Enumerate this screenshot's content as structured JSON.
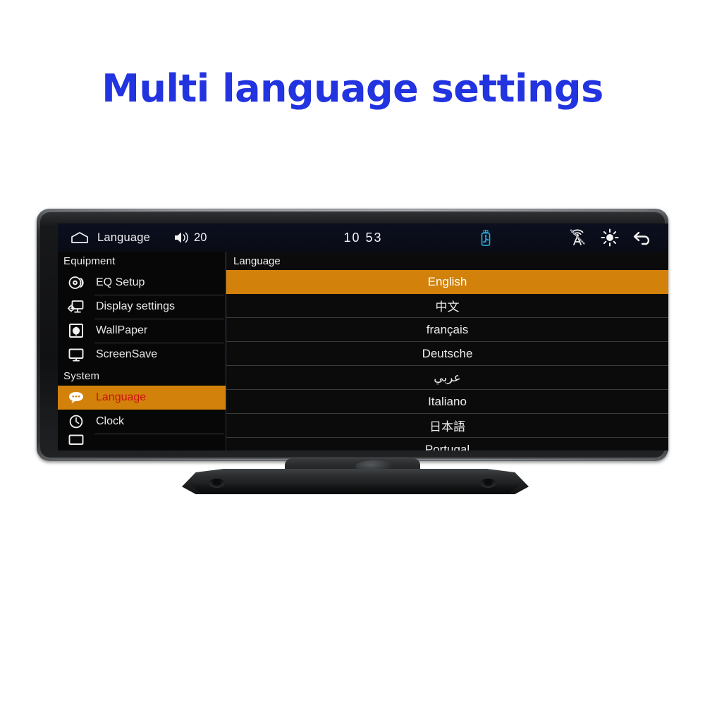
{
  "page": {
    "title": "Multi language settings",
    "title_color": "#2233e0",
    "background": "#ffffff"
  },
  "device": {
    "type": "car-dashcam-monitor",
    "bezel_color": "#1d1e20"
  },
  "screen": {
    "accent_color": "#d2820a",
    "selected_text_color": "#cc1111",
    "statusbar": {
      "home_icon": "home-icon",
      "title": "Language",
      "volume_icon": "volume-icon",
      "volume_value": "20",
      "clock": "10 53",
      "right_icons": [
        {
          "name": "usb-drive-icon",
          "color": "#2aa6d6"
        },
        {
          "name": "wireless-off-icon",
          "color": "#f2f2f2"
        },
        {
          "name": "brightness-icon",
          "color": "#f2f2f2"
        },
        {
          "name": "back-arrow-icon",
          "color": "#f2f2f2"
        }
      ]
    },
    "sidebar": {
      "groups": [
        {
          "label": "Equipment",
          "items": [
            {
              "label": "EQ Setup",
              "icon": "eq-speaker-icon",
              "active": false
            },
            {
              "label": "Display settings",
              "icon": "monitor-gear-icon",
              "active": false
            },
            {
              "label": "WallPaper",
              "icon": "picture-frame-icon",
              "active": false
            },
            {
              "label": "ScreenSave",
              "icon": "monitor-icon",
              "active": false
            }
          ]
        },
        {
          "label": "System",
          "items": [
            {
              "label": "Language",
              "icon": "speech-bubble-icon",
              "active": true
            },
            {
              "label": "Clock",
              "icon": "clock-icon",
              "active": false
            }
          ]
        }
      ]
    },
    "content": {
      "header": "Language",
      "options": [
        {
          "label": "English",
          "selected": true,
          "script": "latin"
        },
        {
          "label": "中文",
          "selected": false,
          "script": "cjk"
        },
        {
          "label": "français",
          "selected": false,
          "script": "latin"
        },
        {
          "label": "Deutsche",
          "selected": false,
          "script": "latin"
        },
        {
          "label": "عربي",
          "selected": false,
          "script": "rtl"
        },
        {
          "label": "Italiano",
          "selected": false,
          "script": "latin"
        },
        {
          "label": "日本語",
          "selected": false,
          "script": "cjk"
        },
        {
          "label": "Portugal",
          "selected": false,
          "script": "latin"
        }
      ]
    }
  }
}
